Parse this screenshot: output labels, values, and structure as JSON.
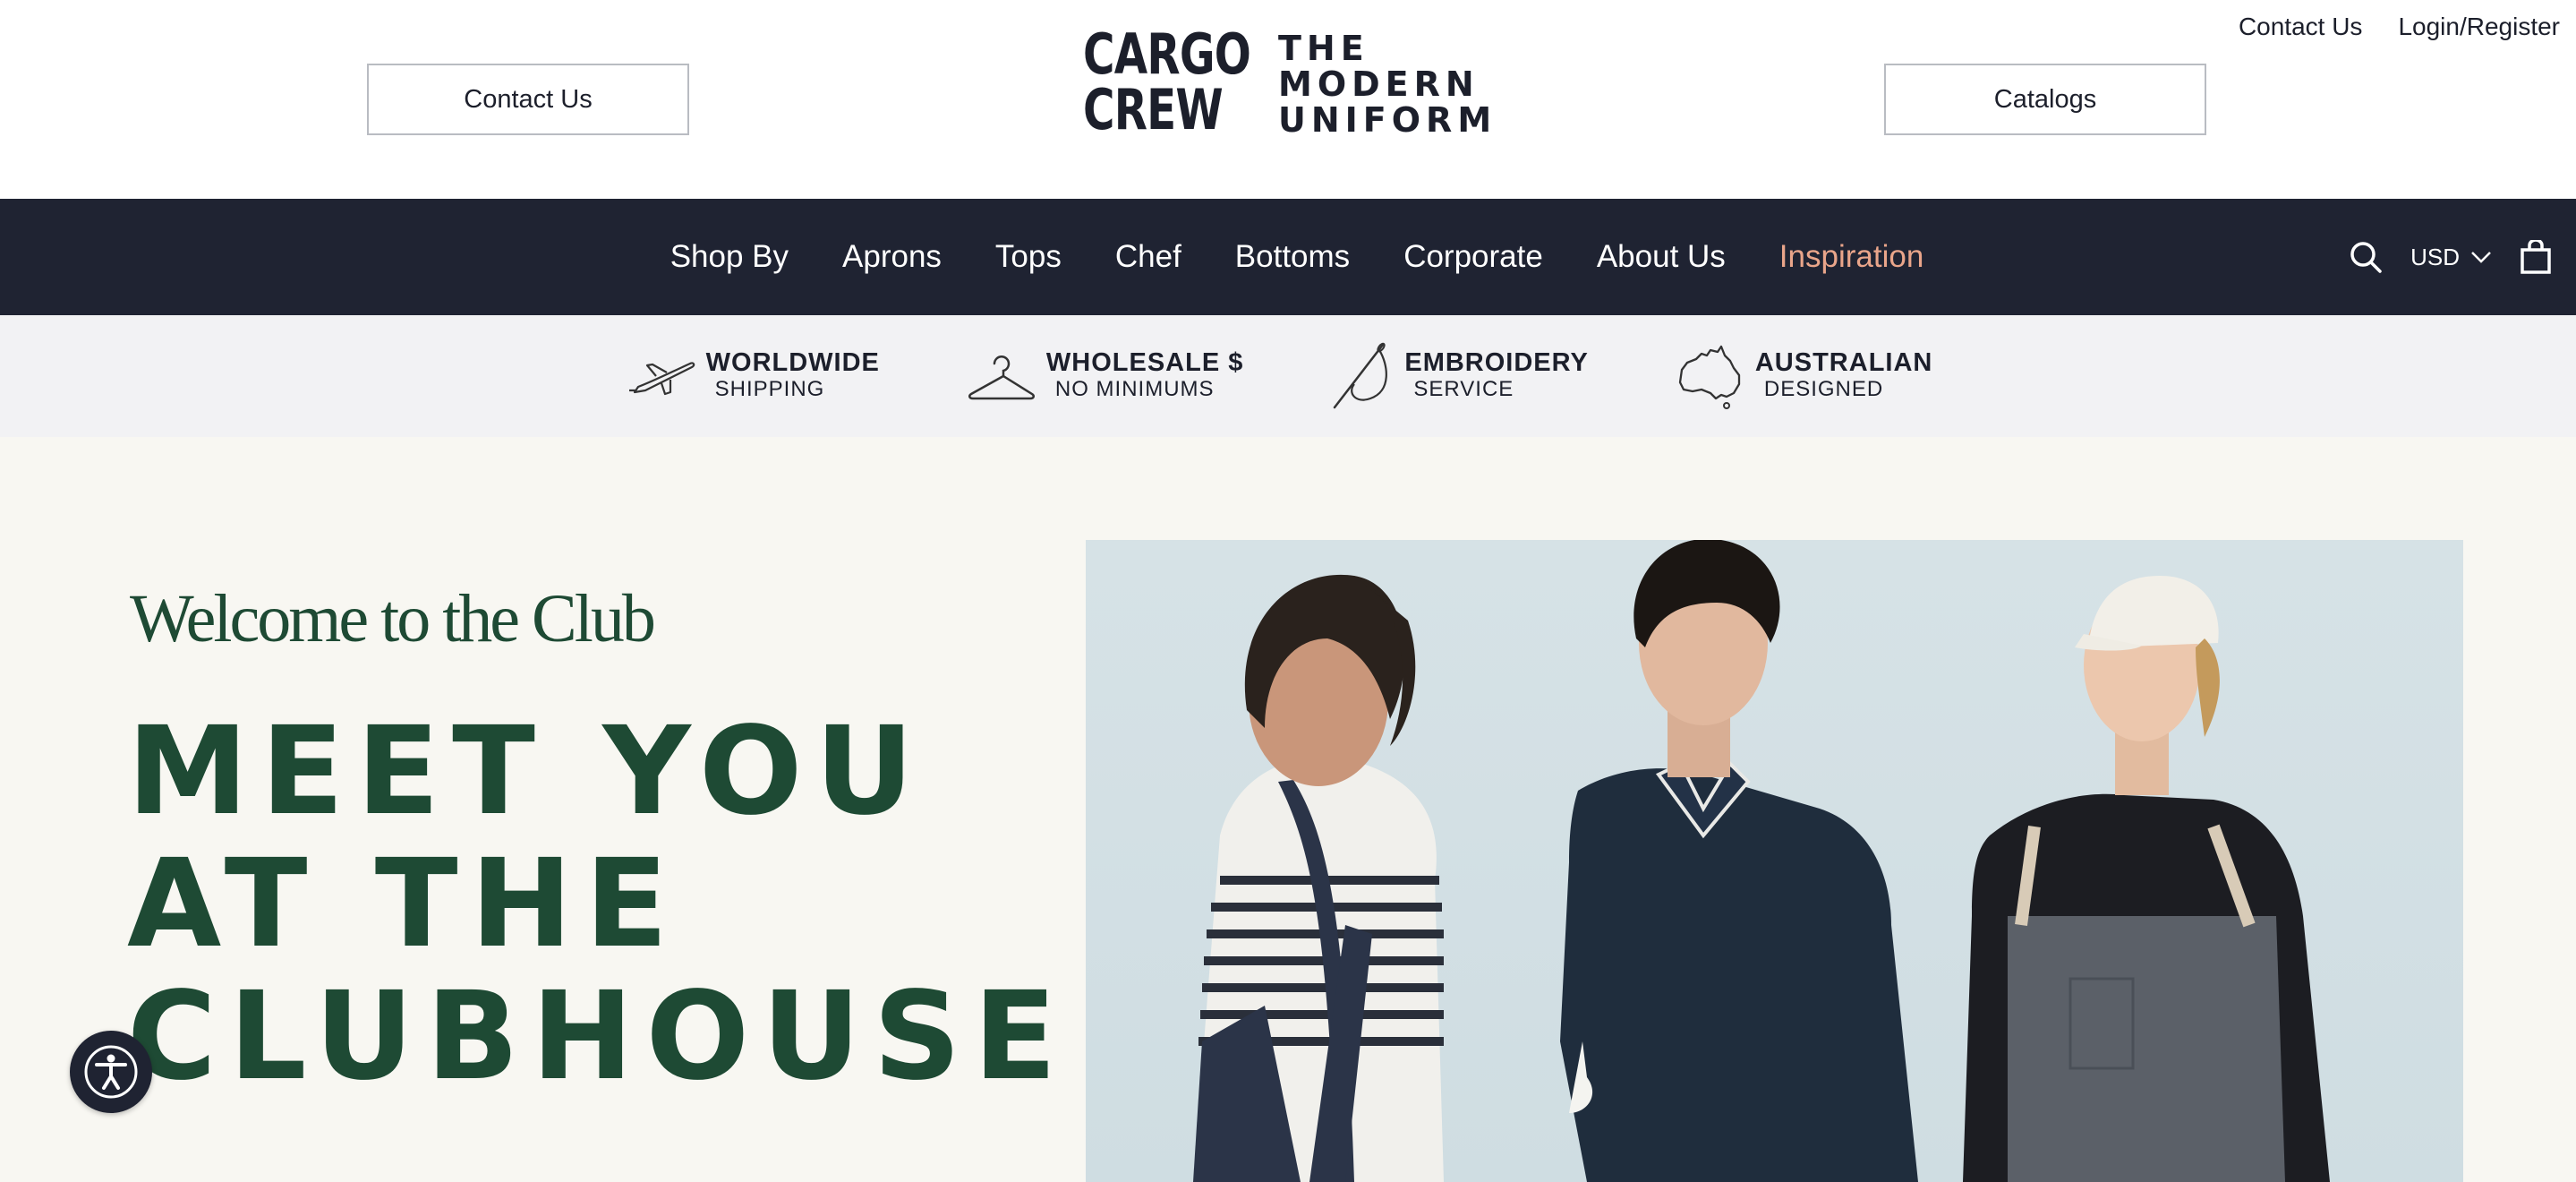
{
  "header": {
    "contact_button": "Contact Us",
    "catalogs_button": "Catalogs",
    "util_links": [
      "Contact Us",
      "Login/Register"
    ],
    "logo": {
      "line1": "CARGO",
      "line2": "CREW",
      "tag1": "THE",
      "tag2": "MODERN",
      "tag3": "UNIFORM"
    }
  },
  "nav": {
    "items": [
      "Shop By",
      "Aprons",
      "Tops",
      "Chef",
      "Bottoms",
      "Corporate",
      "About Us",
      "Inspiration"
    ],
    "highlight_color": "#e9a58a",
    "currency": "USD",
    "icons": [
      "search-icon",
      "chevron-down-icon",
      "shopping-bag-icon"
    ]
  },
  "benefits": [
    {
      "title": "WORLDWIDE",
      "sub": "SHIPPING",
      "icon": "airplane-icon"
    },
    {
      "title": "WHOLESALE $",
      "sub": "NO MINIMUMS",
      "icon": "hanger-icon"
    },
    {
      "title": "EMBROIDERY",
      "sub": "SERVICE",
      "icon": "needle-icon"
    },
    {
      "title": "AUSTRALIAN",
      "sub": "DESIGNED",
      "icon": "australia-map-icon"
    }
  ],
  "hero": {
    "eyebrow": "Welcome to the Club",
    "title_lines": [
      "MEET YOU",
      "AT THE",
      "CLUBHOUSE"
    ],
    "brand_color": "#1e4a34"
  },
  "accessibility": {
    "icon": "accessibility-icon"
  }
}
